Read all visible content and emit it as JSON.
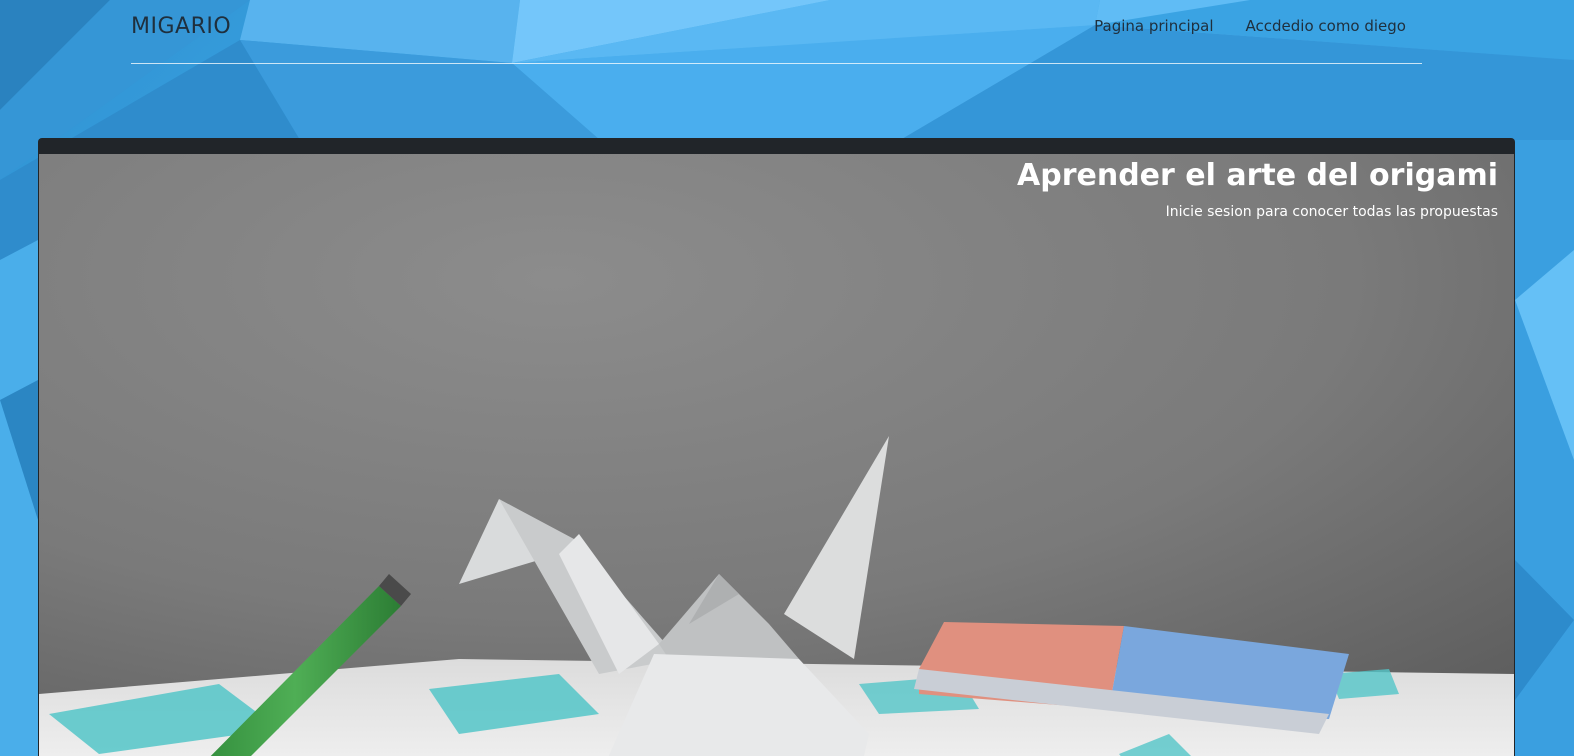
{
  "navbar": {
    "brand": "MIGARIO",
    "links": [
      {
        "label": "Pagina principal"
      },
      {
        "label": "Accdedio como diego"
      }
    ]
  },
  "hero": {
    "title": "Aprender el arte del origami",
    "subtitle": "Inicie sesion para conocer todas las propuestas",
    "image_subject": "origami crane with pencil, eraser and folding diagrams"
  },
  "colors": {
    "background": "#3aa7e6",
    "card_header": "#212529",
    "nav_text": "#1f2f3d",
    "hero_text": "#ffffff"
  }
}
